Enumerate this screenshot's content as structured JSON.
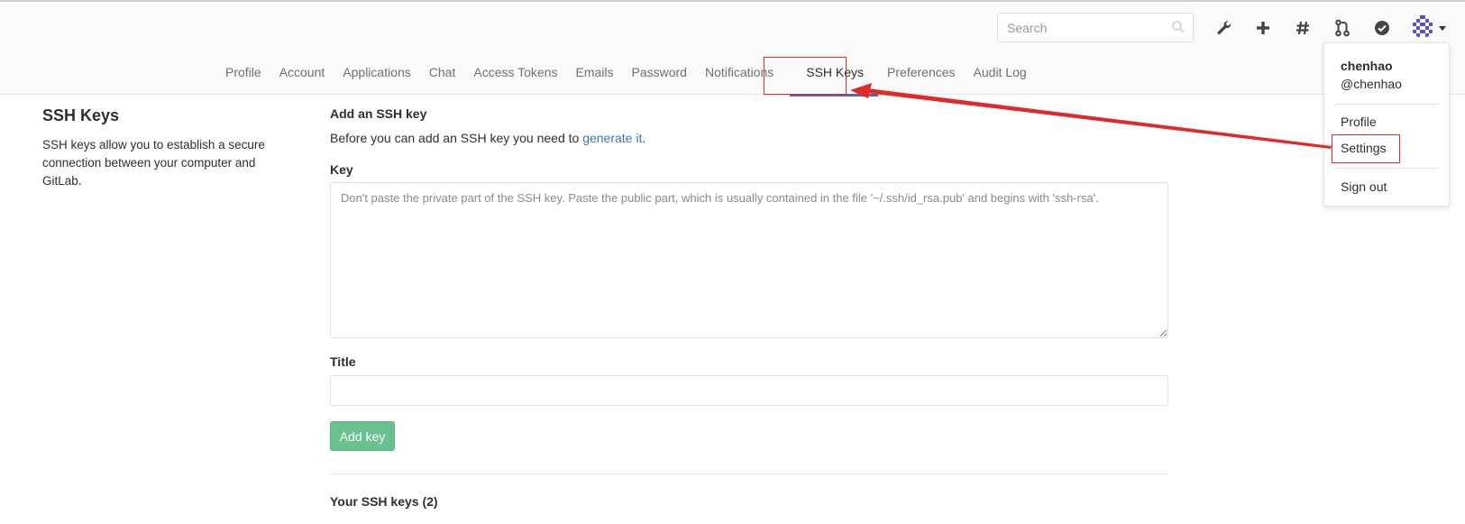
{
  "header": {
    "search": {
      "placeholder": "Search",
      "value": ""
    },
    "icons": [
      "wrench-icon",
      "plus-icon",
      "hash-icon",
      "merge-request-icon",
      "check-circle-icon",
      "avatar"
    ]
  },
  "tabs": [
    {
      "label": "Profile"
    },
    {
      "label": "Account"
    },
    {
      "label": "Applications"
    },
    {
      "label": "Chat"
    },
    {
      "label": "Access Tokens"
    },
    {
      "label": "Emails"
    },
    {
      "label": "Password"
    },
    {
      "label": "Notifications"
    },
    {
      "label": "SSH Keys",
      "active": true
    },
    {
      "label": "Preferences"
    },
    {
      "label": "Audit Log"
    }
  ],
  "sidebar_info": {
    "title": "SSH Keys",
    "description": "SSH keys allow you to establish a secure connection between your computer and GitLab."
  },
  "form": {
    "heading": "Add an SSH key",
    "intro_text": "Before you can add an SSH key you need to ",
    "intro_link": "generate it",
    "intro_end": ".",
    "key_label": "Key",
    "key_placeholder": "Don't paste the private part of the SSH key. Paste the public part, which is usually contained in the file '~/.ssh/id_rsa.pub' and begins with 'ssh-rsa'.",
    "title_label": "Title",
    "title_value": "",
    "add_button": "Add key",
    "your_keys": "Your SSH keys (2)"
  },
  "user_menu": {
    "name": "chenhao",
    "handle": "@chenhao",
    "items": [
      "Profile",
      "Settings",
      "Sign out"
    ]
  },
  "colors": {
    "accent_underline": "#5f63a8",
    "link": "#3777b0",
    "add_button": "#69c190",
    "annotation": "#e02a2a"
  }
}
